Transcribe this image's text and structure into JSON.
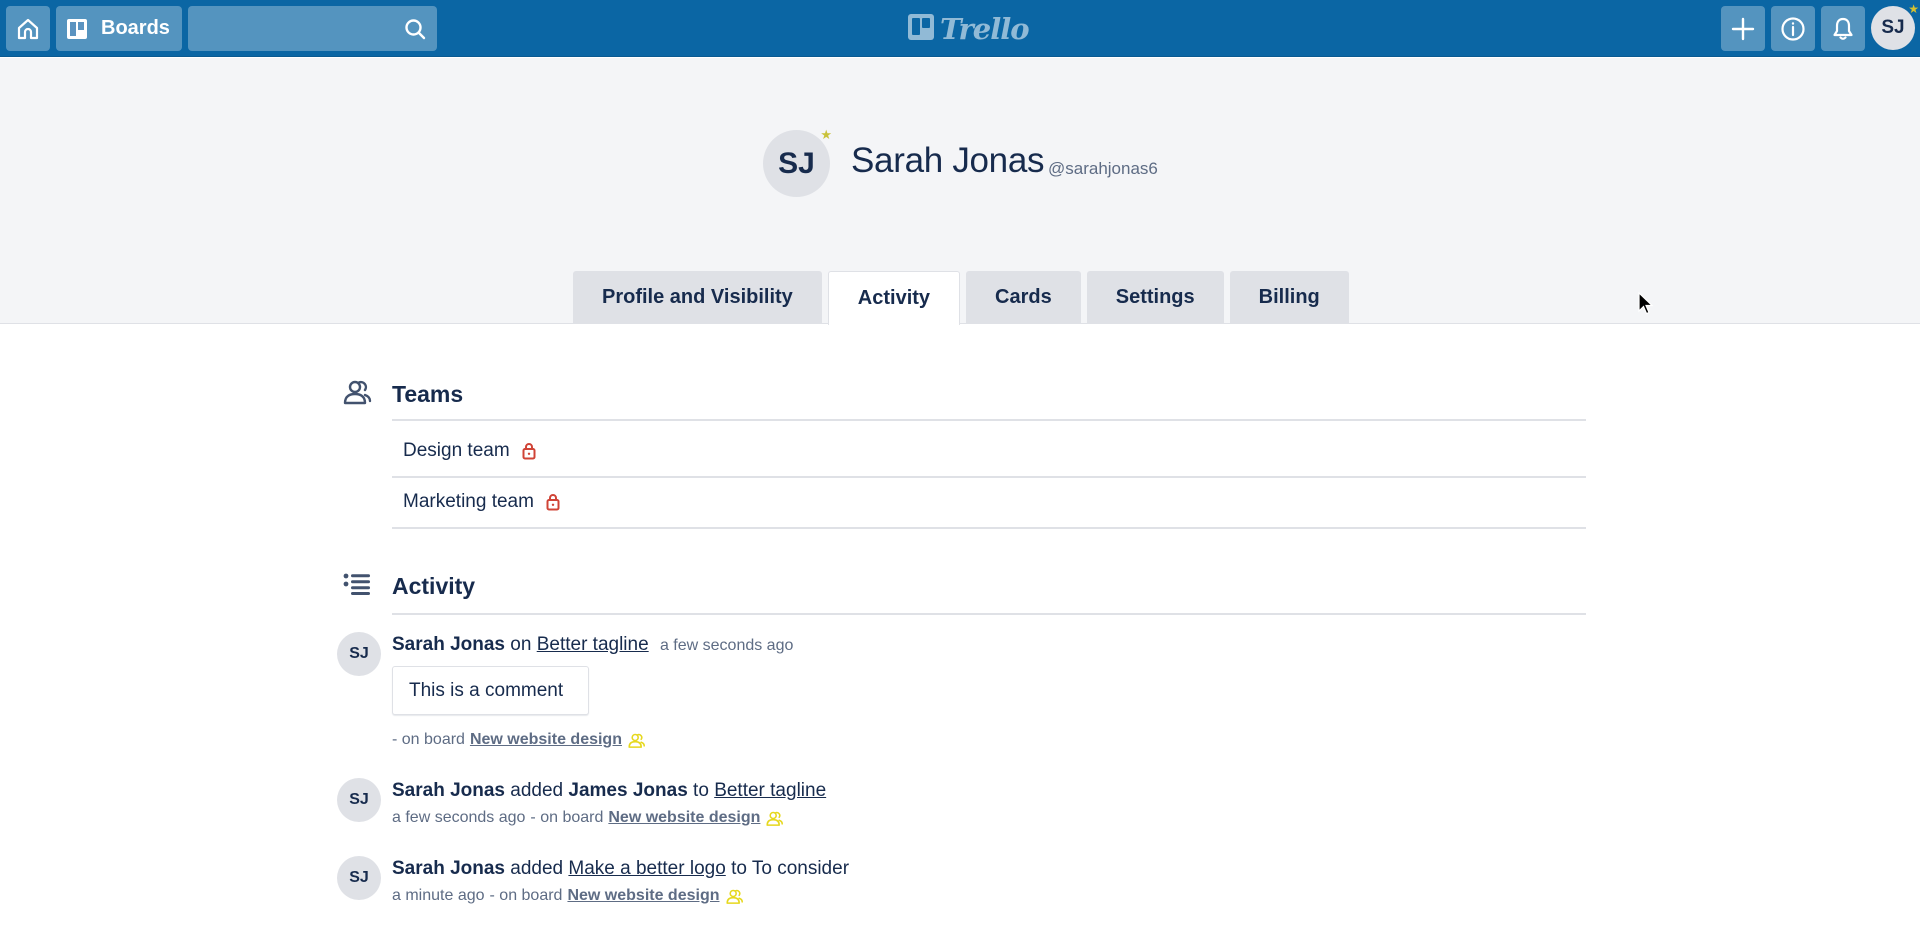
{
  "topbar": {
    "boards_label": "Boards",
    "search_placeholder": "",
    "logo_text": "Trello",
    "user_initials": "SJ"
  },
  "profile": {
    "initials": "SJ",
    "name": "Sarah Jonas",
    "username": "@sarahjonas6"
  },
  "tabs": [
    {
      "label": "Profile and Visibility",
      "active": false
    },
    {
      "label": "Activity",
      "active": true
    },
    {
      "label": "Cards",
      "active": false
    },
    {
      "label": "Settings",
      "active": false
    },
    {
      "label": "Billing",
      "active": false
    }
  ],
  "teams": {
    "title": "Teams",
    "items": [
      {
        "name": "Design team",
        "private": true
      },
      {
        "name": "Marketing team",
        "private": true
      }
    ]
  },
  "activity": {
    "title": "Activity",
    "items": [
      {
        "initials": "SJ",
        "actor": "Sarah Jonas",
        "verb": "on",
        "card": "Better tagline",
        "time": "a few seconds ago",
        "comment": "This is a comment",
        "meta_prefix": "- on board",
        "board": "New website design"
      },
      {
        "initials": "SJ",
        "actor": "Sarah Jonas",
        "verb": "added",
        "member": "James Jonas",
        "prep": "to",
        "card": "Better tagline",
        "time": "a few seconds ago",
        "meta_prefix": "- on board",
        "board": "New website design"
      },
      {
        "initials": "SJ",
        "actor": "Sarah Jonas",
        "verb": "added",
        "card": "Make a better logo",
        "prep": "to",
        "list": "To consider",
        "time": "a minute ago",
        "meta_prefix": "- on board",
        "board": "New website design"
      }
    ]
  },
  "colors": {
    "nav_bg": "#0b66a4",
    "lock_red": "#d04437",
    "team_icon_yellow": "#e6d81e",
    "text": "#172b4d",
    "muted": "#5e6c84"
  }
}
